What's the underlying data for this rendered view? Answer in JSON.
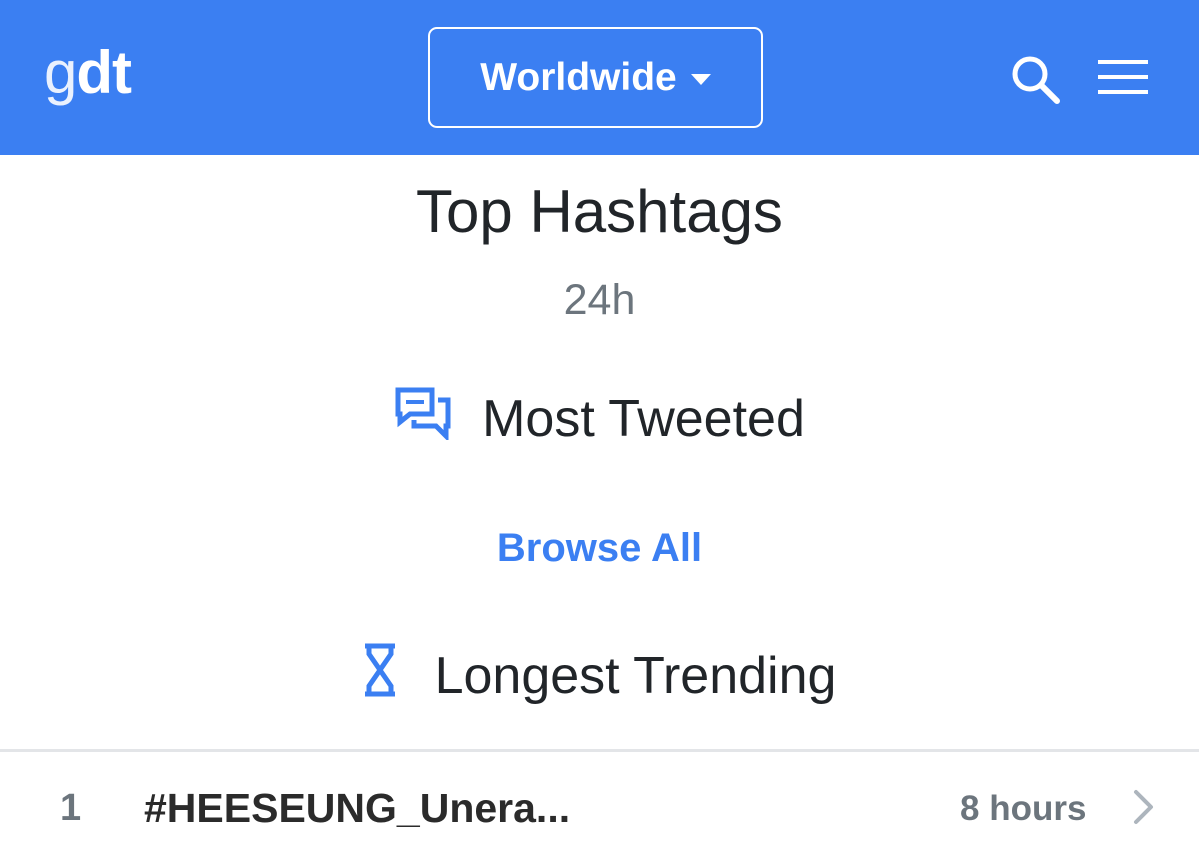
{
  "navbar": {
    "logo_light": "g",
    "logo_bold": "dt",
    "region_label": "Worldwide",
    "icons": [
      "search-icon",
      "menu-icon",
      "caret-down-icon"
    ],
    "background_color": "#3b7ff2"
  },
  "main": {
    "title": "Top Hashtags",
    "period": "24h",
    "most_tweeted_label": "Most Tweeted",
    "most_tweeted_icon": "chat-bubbles-icon",
    "browse_all_label": "Browse All",
    "longest_trending_label": "Longest Trending",
    "longest_trending_icon": "hourglass-icon",
    "accent_color": "#3b7ff2"
  },
  "trends": [
    {
      "rank": "1",
      "hashtag": "#HEESEUNG_Unera...",
      "duration": "8 hours",
      "icon": "chevron-right-icon"
    }
  ]
}
